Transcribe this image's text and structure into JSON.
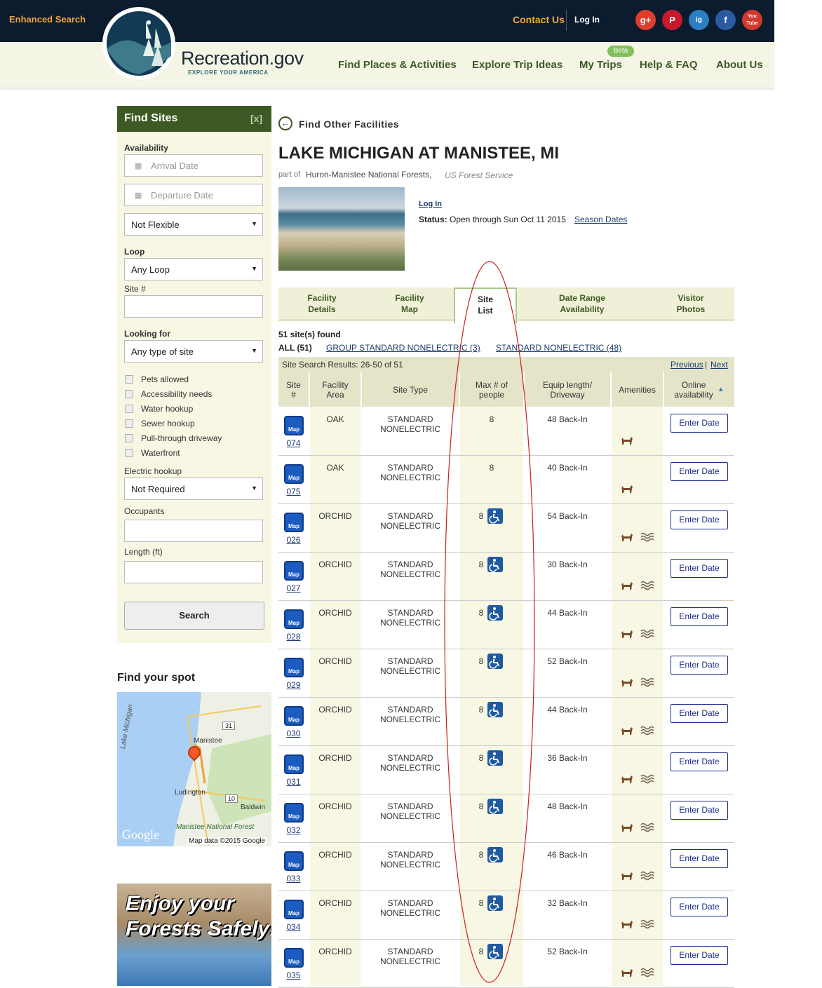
{
  "header": {
    "enhanced_search": "Enhanced Search",
    "contact": "Contact Us",
    "login": "Log In",
    "social": [
      "g+",
      "P",
      "ig",
      "f",
      "You Tube"
    ],
    "logo_title": "Recreation.gov",
    "logo_sub": "EXPLORE YOUR AMERICA",
    "nav": [
      "Find Places & Activities",
      "Explore Trip Ideas",
      "My Trips",
      "Help & FAQ",
      "About Us"
    ],
    "beta": "Beta"
  },
  "sidebar": {
    "title": "Find Sites",
    "close": "[x]",
    "availability": "Availability",
    "arrival_placeholder": "Arrival Date",
    "departure_placeholder": "Departure Date",
    "flexible": "Not Flexible",
    "loop_label": "Loop",
    "loop_value": "Any Loop",
    "site_label": "Site #",
    "looking_label": "Looking for",
    "looking_value": "Any type of site",
    "checkboxes": [
      "Pets allowed",
      "Accessibility needs",
      "Water hookup",
      "Sewer hookup",
      "Pull-through driveway",
      "Waterfront"
    ],
    "electric_label": "Electric hookup",
    "electric_value": "Not Required",
    "occupants_label": "Occupants",
    "length_label": "Length (ft)",
    "search": "Search",
    "find_spot": "Find your spot",
    "map_labels": {
      "lake": "Lake Michigan",
      "manistee": "Manistee",
      "ludington": "Ludington",
      "baldwin": "Baldwin",
      "forest": "Manistee National Forest",
      "google": "Google",
      "mapdata": "Map data ©2015 Google",
      "r31": "31",
      "r10": "10"
    },
    "promo": [
      "Enjoy your",
      "Forests Safely!"
    ]
  },
  "main": {
    "back": "Find Other Facilities",
    "title": "LAKE MICHIGAN AT MANISTEE, MI",
    "part_of": "part of",
    "forest": "Huron-Manistee National Forests,",
    "agency": "US Forest Service",
    "login": "Log In",
    "status_label": "Status:",
    "status_value": "Open through Sun Oct 11 2015",
    "season": "Season Dates",
    "tabs": [
      {
        "line1": "Facility",
        "line2": "Details"
      },
      {
        "line1": "Facility",
        "line2": "Map"
      },
      {
        "line1": "Site",
        "line2": "List"
      },
      {
        "line1": "Date Range",
        "line2": "Availability"
      },
      {
        "line1": "Visitor",
        "line2": "Photos"
      }
    ],
    "found": "51 site(s) found",
    "filter_all": "ALL (51)",
    "filter_group": "GROUP STANDARD NONELECTRIC (3)",
    "filter_std": "STANDARD NONELECTRIC (48)",
    "results_label": "Site Search Results: 26-50 of 51",
    "previous": "Previous",
    "pipe": "|",
    "next": "Next",
    "columns": {
      "site1": "Site",
      "site2": "#",
      "area1": "Facility",
      "area2": "Area",
      "type": "Site Type",
      "max1": "Max # of",
      "max2": "people",
      "equip1": "Equip length/",
      "equip2": "Driveway",
      "amen": "Amenities",
      "online1": "Online",
      "online2": "availability"
    },
    "map_label": "Map",
    "type_line1": "STANDARD",
    "type_line2": "NONELECTRIC",
    "enter_date": "Enter Date",
    "rows": [
      {
        "site": "074",
        "area": "OAK",
        "max": "8",
        "equip": "48 Back-In",
        "acc": false,
        "water": false
      },
      {
        "site": "075",
        "area": "OAK",
        "max": "8",
        "equip": "40 Back-In",
        "acc": false,
        "water": false
      },
      {
        "site": "026",
        "area": "ORCHID",
        "max": "8",
        "equip": "54 Back-In",
        "acc": true,
        "water": true
      },
      {
        "site": "027",
        "area": "ORCHID",
        "max": "8",
        "equip": "30 Back-In",
        "acc": true,
        "water": true
      },
      {
        "site": "028",
        "area": "ORCHID",
        "max": "8",
        "equip": "44 Back-In",
        "acc": true,
        "water": true
      },
      {
        "site": "029",
        "area": "ORCHID",
        "max": "8",
        "equip": "52 Back-In",
        "acc": true,
        "water": true
      },
      {
        "site": "030",
        "area": "ORCHID",
        "max": "8",
        "equip": "44 Back-In",
        "acc": true,
        "water": true
      },
      {
        "site": "031",
        "area": "ORCHID",
        "max": "8",
        "equip": "36 Back-In",
        "acc": true,
        "water": true
      },
      {
        "site": "032",
        "area": "ORCHID",
        "max": "8",
        "equip": "48 Back-In",
        "acc": true,
        "water": true
      },
      {
        "site": "033",
        "area": "ORCHID",
        "max": "8",
        "equip": "46 Back-In",
        "acc": true,
        "water": true
      },
      {
        "site": "034",
        "area": "ORCHID",
        "max": "8",
        "equip": "32 Back-In",
        "acc": true,
        "water": true
      },
      {
        "site": "035",
        "area": "ORCHID",
        "max": "8",
        "equip": "52 Back-In",
        "acc": true,
        "water": true
      }
    ]
  }
}
